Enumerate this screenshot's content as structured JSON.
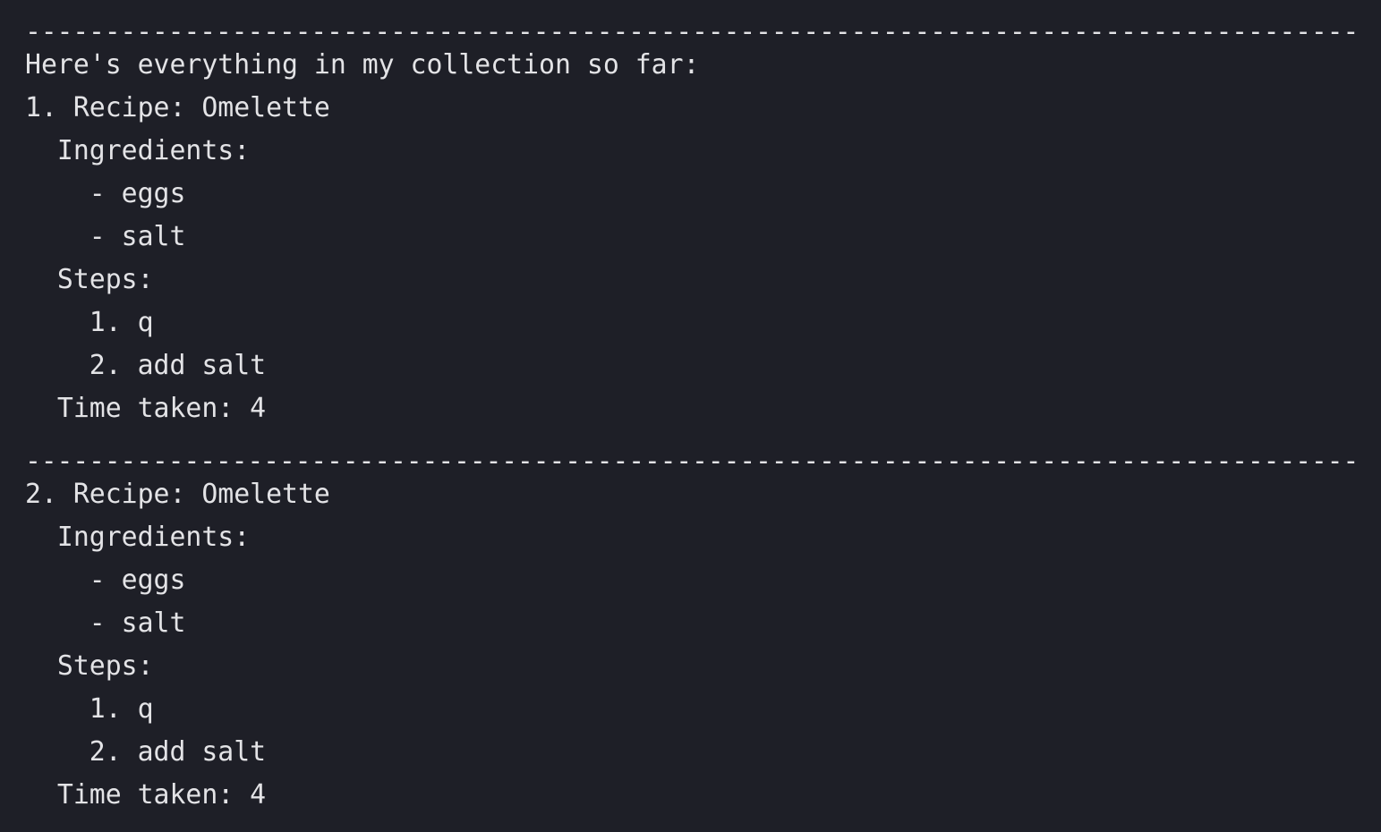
{
  "terminal": {
    "separator": "-------------------------------------------------------------------------------------------------------------",
    "intro": "Here's everything in my collection so far:",
    "recipes": [
      {
        "title": "1. Recipe: Omelette",
        "ingredients_label": "  Ingredients:",
        "ingredients": [
          "    - eggs",
          "    - salt"
        ],
        "steps_label": "  Steps:",
        "steps": [
          "    1. q",
          "    2. add salt"
        ],
        "time": "  Time taken: 4"
      },
      {
        "title": "2. Recipe: Omelette",
        "ingredients_label": "  Ingredients:",
        "ingredients": [
          "    - eggs",
          "    - salt"
        ],
        "steps_label": "  Steps:",
        "steps": [
          "    1. q",
          "    2. add salt"
        ],
        "time": "  Time taken: 4"
      }
    ]
  },
  "colors": {
    "background": "#1e1f27",
    "text": "#e3e3e6"
  }
}
